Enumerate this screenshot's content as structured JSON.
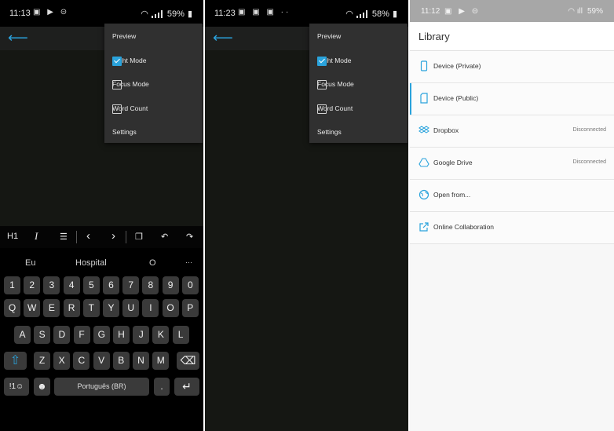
{
  "left": {
    "status": {
      "time": "11:13",
      "battery": "59%"
    },
    "menu": [
      {
        "label": "Preview",
        "checkbox": false
      },
      {
        "label": "Night Mode",
        "checkbox": true,
        "checked": true
      },
      {
        "label": "Focus Mode",
        "checkbox": true,
        "checked": false
      },
      {
        "label": "Word Count",
        "checkbox": true,
        "checked": false
      },
      {
        "label": "Settings",
        "checkbox": false
      }
    ],
    "toolbar": {
      "h1": "H1",
      "italic": "I",
      "list": "☰",
      "prev": "‹",
      "next": "›",
      "copy": "❐",
      "undo": "↶",
      "redo": "↷"
    },
    "suggestions": [
      "Eu",
      "Hospital",
      "O",
      "···"
    ],
    "keys": {
      "row_numbers": [
        "1",
        "2",
        "3",
        "4",
        "5",
        "6",
        "7",
        "8",
        "9",
        "0"
      ],
      "row1": [
        "Q",
        "W",
        "E",
        "R",
        "T",
        "Y",
        "U",
        "I",
        "O",
        "P"
      ],
      "row2": [
        "A",
        "S",
        "D",
        "F",
        "G",
        "H",
        "J",
        "K",
        "L"
      ],
      "row3": [
        "Z",
        "X",
        "C",
        "V",
        "B",
        "N",
        "M"
      ],
      "shift": "⇧",
      "backspace": "⌫",
      "symbols": "!1☺",
      "emoji": "☻",
      "space": "Português (BR)",
      "period": ".",
      "enter": "↵"
    }
  },
  "middle": {
    "status": {
      "time": "11:23",
      "battery": "58%"
    },
    "menu": [
      {
        "label": "Preview",
        "checkbox": false
      },
      {
        "label": "Night Mode",
        "checkbox": true,
        "checked": true
      },
      {
        "label": "Focus Mode",
        "checkbox": true,
        "checked": false
      },
      {
        "label": "Word Count",
        "checkbox": true,
        "checked": false
      },
      {
        "label": "Settings",
        "checkbox": false
      }
    ]
  },
  "right": {
    "status": {
      "time": "11:12",
      "battery": "59%"
    },
    "title": "Library",
    "items": [
      {
        "label": "Device (Private)",
        "icon": "phone-icon",
        "status": ""
      },
      {
        "label": "Device (Public)",
        "icon": "sd-card-icon",
        "status": "",
        "selected": true
      },
      {
        "label": "Dropbox",
        "icon": "dropbox-icon",
        "status": "Disconnected"
      },
      {
        "label": "Google Drive",
        "icon": "google-drive-icon",
        "status": "Disconnected"
      },
      {
        "label": "Open from...",
        "icon": "globe-icon",
        "status": ""
      },
      {
        "label": "Online Collaboration",
        "icon": "external-link-icon",
        "status": ""
      }
    ]
  },
  "colors": {
    "accent": "#2aa3dc",
    "dark_bg": "#151713",
    "menu_bg": "#303030"
  }
}
